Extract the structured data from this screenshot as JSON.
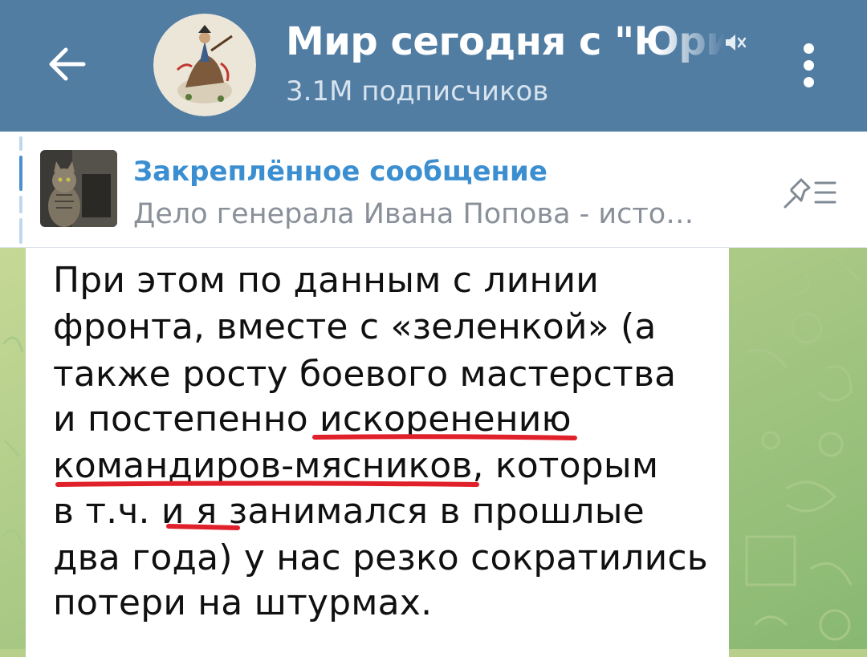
{
  "header": {
    "title": "Мир сегодня с \"Юрий",
    "subscribers": "3.1M подписчиков",
    "back_icon": "arrow-left-icon",
    "mute_icon": "muted-speaker-icon",
    "menu_icon": "more-vertical-icon"
  },
  "pinned": {
    "title": "Закреплённое сообщение",
    "text": "Дело генерала Ивана Попова - исто…",
    "list_icon": "pinned-list-icon"
  },
  "message": {
    "lines": [
      "При этом по данным с линии",
      "фронта, вместе с «зеленкой» (а",
      "также росту боевого мастерства",
      "и постепенно искоренению",
      "командиров-мясников, которым",
      "в т.ч. и я занимался в прошлые",
      "два года) у нас резко сократились",
      "потери на штурмах."
    ]
  },
  "colors": {
    "header_bg": "#527da3",
    "accent": "#3b8fd1",
    "highlight": "#e0202a",
    "chat_bg": "#b7cf8a"
  }
}
